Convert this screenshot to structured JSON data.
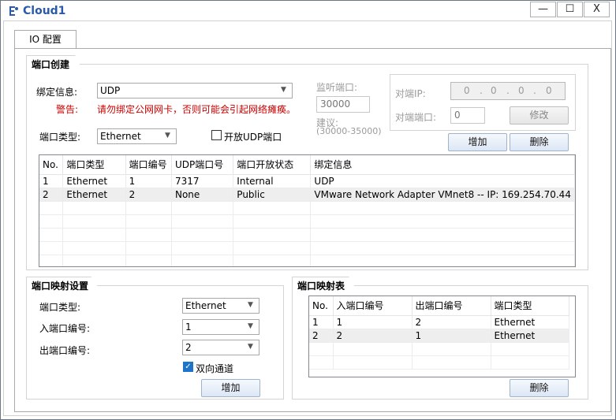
{
  "window": {
    "title": "Cloud1",
    "minimize": "—",
    "maximize": "☐",
    "close": "X"
  },
  "tabs": [
    {
      "label": "IO 配置"
    }
  ],
  "port_create": {
    "title": "端口创建",
    "binding_label": "绑定信息:",
    "binding_value": "UDP",
    "warning_label": "警告:",
    "warning_text": "请勿绑定公网网卡，否则可能会引起网络瘫痪。",
    "port_type_label": "端口类型:",
    "port_type_value": "Ethernet",
    "open_udp_label": "开放UDP端口",
    "open_udp_checked": false,
    "listen_port_label": "监听端口:",
    "listen_port_value": "30000",
    "suggest_label": "建议:",
    "suggest_range": "(30000-35000)",
    "peer_ip_label": "对端IP:",
    "peer_ip_value": [
      "0",
      "0",
      "0",
      "0"
    ],
    "peer_port_label": "对端端口:",
    "peer_port_value": "0",
    "modify_button": "修改",
    "add_button": "增加",
    "delete_button": "删除",
    "table": {
      "columns": [
        "No.",
        "端口类型",
        "端口编号",
        "UDP端口号",
        "端口开放状态",
        "绑定信息"
      ],
      "rows": [
        [
          "1",
          "Ethernet",
          "1",
          "7317",
          "Internal",
          "UDP"
        ],
        [
          "2",
          "Ethernet",
          "2",
          "None",
          "Public",
          "VMware Network Adapter VMnet8 -- IP: 169.254.70.44"
        ]
      ]
    }
  },
  "mapping_settings": {
    "title": "端口映射设置",
    "port_type_label": "端口类型:",
    "port_type_value": "Ethernet",
    "in_port_label": "入端口编号:",
    "in_port_value": "1",
    "out_port_label": "出端口编号:",
    "out_port_value": "2",
    "bidirectional_label": "双向通道",
    "bidirectional_checked": true,
    "add_button": "增加"
  },
  "mapping_table": {
    "title": "端口映射表",
    "columns": [
      "No.",
      "入端口编号",
      "出端口编号",
      "端口类型"
    ],
    "rows": [
      [
        "1",
        "1",
        "2",
        "Ethernet"
      ],
      [
        "2",
        "2",
        "1",
        "Ethernet"
      ]
    ],
    "delete_button": "删除"
  },
  "colors": {
    "title": "#2a5aa8",
    "warning": "#cc0000",
    "checkbox_accent": "#1e74c9"
  }
}
